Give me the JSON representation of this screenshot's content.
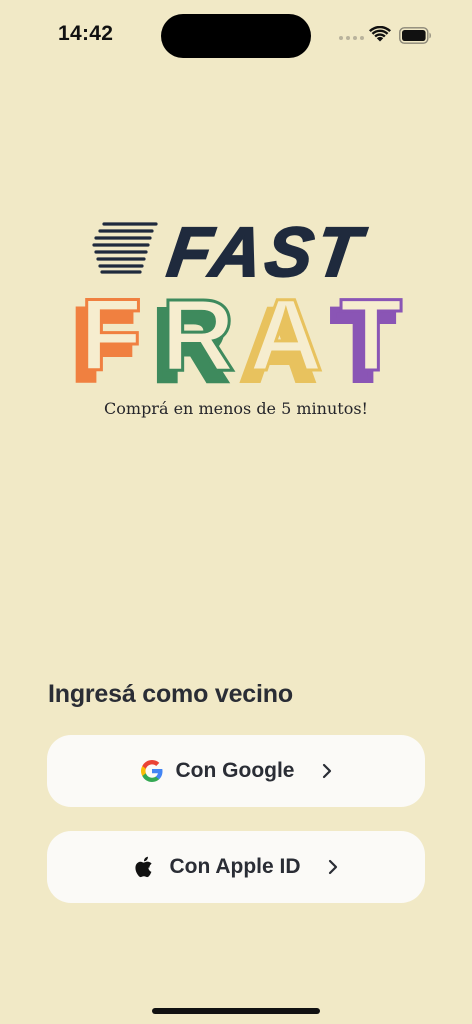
{
  "status_bar": {
    "time": "14:42",
    "icons": [
      "signal-dots-icon",
      "wifi-icon",
      "battery-icon"
    ]
  },
  "brand": {
    "logo_line1": "FAST",
    "logo_line2_letters": [
      "F",
      "R",
      "A",
      "T"
    ],
    "logo_colors": {
      "fast": "#1f2a3d",
      "F": "#f08040",
      "R": "#3e8a5d",
      "A": "#e8c25e",
      "T": "#8a55b5",
      "letter_fill": "#f6edcf"
    },
    "tagline": "Comprá en menos de 5 minutos!"
  },
  "login": {
    "title": "Ingresá como vecino",
    "google_label": "Con Google",
    "apple_label": "Con Apple ID"
  },
  "colors": {
    "background": "#f1e9c6",
    "button_bg": "#fbfaf7",
    "text": "#2a2d35"
  }
}
